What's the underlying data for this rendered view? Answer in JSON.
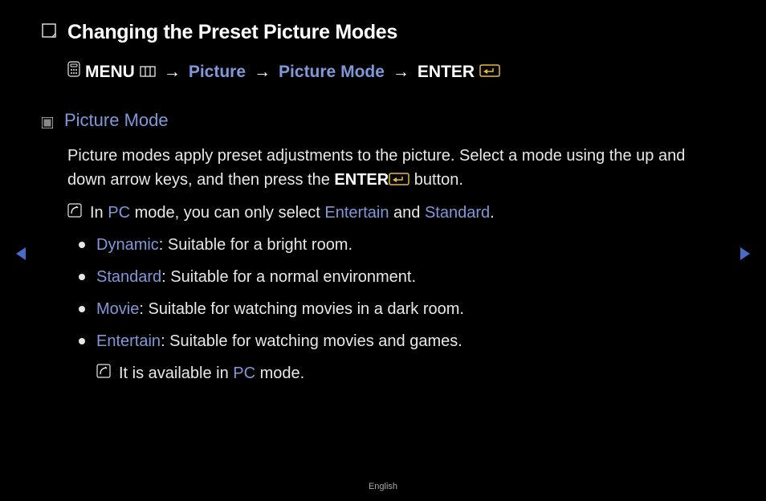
{
  "title": "Changing the Preset Picture Modes",
  "path": {
    "menu_label": "MENU",
    "step1": "Picture",
    "step2": "Picture Mode",
    "enter_label": "ENTER",
    "arrow": "→"
  },
  "section": {
    "heading": "Picture Mode",
    "intro_a": "Picture modes apply preset adjustments to the picture. Select a mode using the up and down arrow keys, and then press the ",
    "intro_enter": "ENTER",
    "intro_b": " button.",
    "pc_note_a": "In ",
    "pc_note_pc": "PC",
    "pc_note_b": " mode, you can only select ",
    "pc_note_ent": "Entertain",
    "pc_note_c": " and ",
    "pc_note_std": "Standard",
    "pc_note_d": ".",
    "items": [
      {
        "label": "Dynamic",
        "desc": ": Suitable for a bright room."
      },
      {
        "label": "Standard",
        "desc": ": Suitable for a normal environment."
      },
      {
        "label": "Movie",
        "desc": ": Suitable for watching movies in a dark room."
      },
      {
        "label": "Entertain",
        "desc": ": Suitable for watching movies and games."
      }
    ],
    "sub_note_a": "It is available in ",
    "sub_note_pc": "PC",
    "sub_note_b": " mode."
  },
  "footer": "English"
}
